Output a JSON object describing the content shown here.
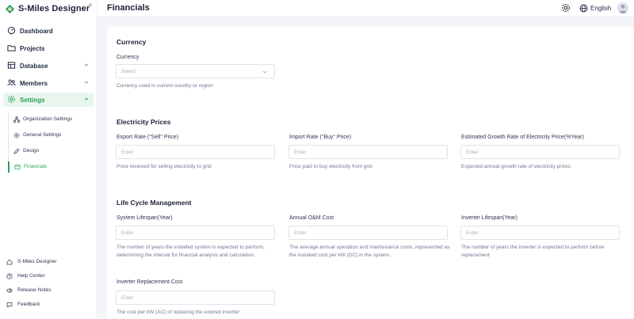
{
  "app": {
    "brand": "S-Miles Designer",
    "collapse_glyph": "«"
  },
  "sidebar": {
    "items": [
      {
        "label": "Dashboard",
        "icon": "dashboard-icon"
      },
      {
        "label": "Projects",
        "icon": "folder-icon"
      },
      {
        "label": "Database",
        "icon": "database-icon"
      },
      {
        "label": "Members",
        "icon": "members-icon"
      },
      {
        "label": "Settings",
        "icon": "gear-icon"
      }
    ],
    "settings_sub": [
      {
        "label": "Organization Settings",
        "icon": "org-icon"
      },
      {
        "label": "General Settings",
        "icon": "general-settings-icon"
      },
      {
        "label": "Design",
        "icon": "design-icon"
      },
      {
        "label": "Financials",
        "icon": "financials-icon"
      }
    ],
    "footer": [
      {
        "label": "S-Miles Designer",
        "icon": "home-icon"
      },
      {
        "label": "Help Center",
        "icon": "help-icon"
      },
      {
        "label": "Release Notes",
        "icon": "release-notes-icon"
      },
      {
        "label": "Feedback",
        "icon": "feedback-icon"
      }
    ]
  },
  "header": {
    "title": "Financials",
    "language": "English"
  },
  "currency": {
    "title": "Currency",
    "label": "Currency",
    "placeholder": "Select",
    "help": "Currency used in current country or region"
  },
  "electricity": {
    "title": "Electricity Prices",
    "export": {
      "label": "Export Rate (\"Sell\" Price)",
      "placeholder": "Enter",
      "help": "Price received for selling electricity to grid"
    },
    "import": {
      "label": "Import Rate (\"Buy\" Price)",
      "placeholder": "Enter",
      "help": "Price paid to buy electricity from grid"
    },
    "growth": {
      "label": "Estimated Growth Rate of Electricity Price(%Year)",
      "placeholder": "Enter",
      "help": "Expected annual growth rate of electricity prices"
    }
  },
  "lifecycle": {
    "title": "Life Cycle Management",
    "lifespan": {
      "label": "System Lifespan(Year)",
      "placeholder": "Enter",
      "help": "The number of years the installed system is expected to perform, determining the interval for financial analysis and calculation."
    },
    "om": {
      "label": "Annual O&M Cost",
      "placeholder": "Enter",
      "help": "The average annual operation and maintenance costs, represented as the installed cost per kW (DC) in the system."
    },
    "inverter_life": {
      "label": "Inverter Lifespan(Year)",
      "placeholder": "Enter",
      "help": "The number of years the inverter is expected to perform before replacement"
    },
    "inverter_cost": {
      "label": "Inverter Replacement Cost",
      "placeholder": "Enter",
      "help": "The cost per kW (AC) of replacing the expired inverter"
    }
  },
  "colors": {
    "accent": "#27a35a",
    "accent_bg": "#e9f6ee",
    "text": "#1f2a44",
    "muted": "#6f7a90"
  }
}
